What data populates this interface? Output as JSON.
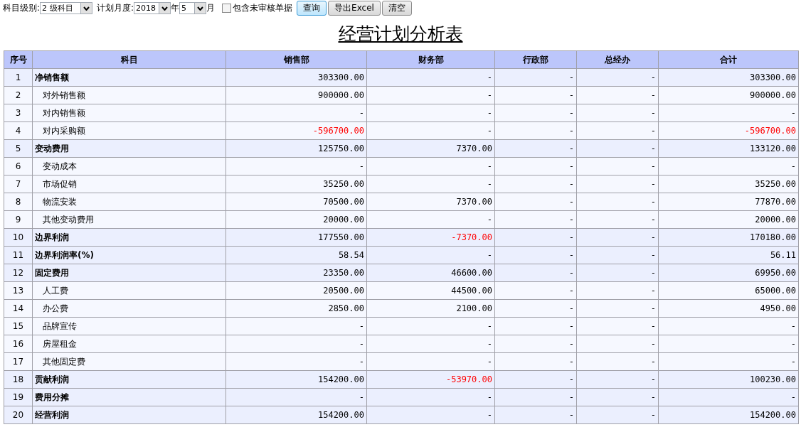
{
  "toolbar": {
    "level_label": "科目级别:",
    "level_value": "2 级科目",
    "month_label": "计划月度:",
    "year_value": "2018",
    "year_unit": "年",
    "month_value": "5",
    "month_unit": "月",
    "include_unaudited": {
      "label": "包含未审核单据",
      "checked": false
    },
    "buttons": [
      {
        "label": "查询",
        "selected": true
      },
      {
        "label": "导出Excel",
        "selected": false
      },
      {
        "label": "清空",
        "selected": false
      }
    ]
  },
  "title": "经营计划分析表",
  "table": {
    "columns": [
      "序号",
      "科目",
      "销售部",
      "财务部",
      "行政部",
      "总经办",
      "合计"
    ],
    "rows": [
      {
        "kind": "group",
        "cells": [
          {
            "text": "1",
            "negative": false
          },
          {
            "text": "净销售额",
            "negative": false
          },
          {
            "text": "303300.00",
            "negative": false
          },
          {
            "text": "-",
            "negative": false
          },
          {
            "text": "-",
            "negative": false
          },
          {
            "text": "-",
            "negative": false
          },
          {
            "text": "303300.00",
            "negative": false
          }
        ]
      },
      {
        "kind": "item",
        "cells": [
          {
            "text": "2",
            "negative": false
          },
          {
            "text": "对外销售额",
            "negative": false
          },
          {
            "text": "900000.00",
            "negative": false
          },
          {
            "text": "-",
            "negative": false
          },
          {
            "text": "-",
            "negative": false
          },
          {
            "text": "-",
            "negative": false
          },
          {
            "text": "900000.00",
            "negative": false
          }
        ]
      },
      {
        "kind": "item",
        "cells": [
          {
            "text": "3",
            "negative": false
          },
          {
            "text": "对内销售额",
            "negative": false
          },
          {
            "text": "-",
            "negative": false
          },
          {
            "text": "-",
            "negative": false
          },
          {
            "text": "-",
            "negative": false
          },
          {
            "text": "-",
            "negative": false
          },
          {
            "text": "-",
            "negative": false
          }
        ]
      },
      {
        "kind": "item",
        "cells": [
          {
            "text": "4",
            "negative": false
          },
          {
            "text": "对内采购额",
            "negative": false
          },
          {
            "text": "-596700.00",
            "negative": true
          },
          {
            "text": "-",
            "negative": false
          },
          {
            "text": "-",
            "negative": false
          },
          {
            "text": "-",
            "negative": false
          },
          {
            "text": "-596700.00",
            "negative": true
          }
        ]
      },
      {
        "kind": "group",
        "cells": [
          {
            "text": "5",
            "negative": false
          },
          {
            "text": "变动费用",
            "negative": false
          },
          {
            "text": "125750.00",
            "negative": false
          },
          {
            "text": "7370.00",
            "negative": false
          },
          {
            "text": "-",
            "negative": false
          },
          {
            "text": "-",
            "negative": false
          },
          {
            "text": "133120.00",
            "negative": false
          }
        ]
      },
      {
        "kind": "item",
        "cells": [
          {
            "text": "6",
            "negative": false
          },
          {
            "text": "变动成本",
            "negative": false
          },
          {
            "text": "-",
            "negative": false
          },
          {
            "text": "-",
            "negative": false
          },
          {
            "text": "-",
            "negative": false
          },
          {
            "text": "-",
            "negative": false
          },
          {
            "text": "-",
            "negative": false
          }
        ]
      },
      {
        "kind": "item",
        "cells": [
          {
            "text": "7",
            "negative": false
          },
          {
            "text": "市场促销",
            "negative": false
          },
          {
            "text": "35250.00",
            "negative": false
          },
          {
            "text": "-",
            "negative": false
          },
          {
            "text": "-",
            "negative": false
          },
          {
            "text": "-",
            "negative": false
          },
          {
            "text": "35250.00",
            "negative": false
          }
        ]
      },
      {
        "kind": "item",
        "cells": [
          {
            "text": "8",
            "negative": false
          },
          {
            "text": "物流安装",
            "negative": false
          },
          {
            "text": "70500.00",
            "negative": false
          },
          {
            "text": "7370.00",
            "negative": false
          },
          {
            "text": "-",
            "negative": false
          },
          {
            "text": "-",
            "negative": false
          },
          {
            "text": "77870.00",
            "negative": false
          }
        ]
      },
      {
        "kind": "item",
        "cells": [
          {
            "text": "9",
            "negative": false
          },
          {
            "text": "其他变动费用",
            "negative": false
          },
          {
            "text": "20000.00",
            "negative": false
          },
          {
            "text": "-",
            "negative": false
          },
          {
            "text": "-",
            "negative": false
          },
          {
            "text": "-",
            "negative": false
          },
          {
            "text": "20000.00",
            "negative": false
          }
        ]
      },
      {
        "kind": "group",
        "cells": [
          {
            "text": "10",
            "negative": false
          },
          {
            "text": "边界利润",
            "negative": false
          },
          {
            "text": "177550.00",
            "negative": false
          },
          {
            "text": "-7370.00",
            "negative": true
          },
          {
            "text": "-",
            "negative": false
          },
          {
            "text": "-",
            "negative": false
          },
          {
            "text": "170180.00",
            "negative": false
          }
        ]
      },
      {
        "kind": "group",
        "cells": [
          {
            "text": "11",
            "negative": false
          },
          {
            "text": "边界利润率(%)",
            "negative": false
          },
          {
            "text": "58.54",
            "negative": false
          },
          {
            "text": "-",
            "negative": false
          },
          {
            "text": "-",
            "negative": false
          },
          {
            "text": "-",
            "negative": false
          },
          {
            "text": "56.11",
            "negative": false
          }
        ]
      },
      {
        "kind": "group",
        "cells": [
          {
            "text": "12",
            "negative": false
          },
          {
            "text": "固定费用",
            "negative": false
          },
          {
            "text": "23350.00",
            "negative": false
          },
          {
            "text": "46600.00",
            "negative": false
          },
          {
            "text": "-",
            "negative": false
          },
          {
            "text": "-",
            "negative": false
          },
          {
            "text": "69950.00",
            "negative": false
          }
        ]
      },
      {
        "kind": "item",
        "cells": [
          {
            "text": "13",
            "negative": false
          },
          {
            "text": "人工费",
            "negative": false
          },
          {
            "text": "20500.00",
            "negative": false
          },
          {
            "text": "44500.00",
            "negative": false
          },
          {
            "text": "-",
            "negative": false
          },
          {
            "text": "-",
            "negative": false
          },
          {
            "text": "65000.00",
            "negative": false
          }
        ]
      },
      {
        "kind": "item",
        "cells": [
          {
            "text": "14",
            "negative": false
          },
          {
            "text": "办公费",
            "negative": false
          },
          {
            "text": "2850.00",
            "negative": false
          },
          {
            "text": "2100.00",
            "negative": false
          },
          {
            "text": "-",
            "negative": false
          },
          {
            "text": "-",
            "negative": false
          },
          {
            "text": "4950.00",
            "negative": false
          }
        ]
      },
      {
        "kind": "item",
        "cells": [
          {
            "text": "15",
            "negative": false
          },
          {
            "text": "品牌宣传",
            "negative": false
          },
          {
            "text": "-",
            "negative": false
          },
          {
            "text": "-",
            "negative": false
          },
          {
            "text": "-",
            "negative": false
          },
          {
            "text": "-",
            "negative": false
          },
          {
            "text": "-",
            "negative": false
          }
        ]
      },
      {
        "kind": "item",
        "cells": [
          {
            "text": "16",
            "negative": false
          },
          {
            "text": "房屋租金",
            "negative": false
          },
          {
            "text": "-",
            "negative": false
          },
          {
            "text": "-",
            "negative": false
          },
          {
            "text": "-",
            "negative": false
          },
          {
            "text": "-",
            "negative": false
          },
          {
            "text": "-",
            "negative": false
          }
        ]
      },
      {
        "kind": "item",
        "cells": [
          {
            "text": "17",
            "negative": false
          },
          {
            "text": "其他固定费",
            "negative": false
          },
          {
            "text": "-",
            "negative": false
          },
          {
            "text": "-",
            "negative": false
          },
          {
            "text": "-",
            "negative": false
          },
          {
            "text": "-",
            "negative": false
          },
          {
            "text": "-",
            "negative": false
          }
        ]
      },
      {
        "kind": "group",
        "cells": [
          {
            "text": "18",
            "negative": false
          },
          {
            "text": "贡献利润",
            "negative": false
          },
          {
            "text": "154200.00",
            "negative": false
          },
          {
            "text": "-53970.00",
            "negative": true
          },
          {
            "text": "-",
            "negative": false
          },
          {
            "text": "-",
            "negative": false
          },
          {
            "text": "100230.00",
            "negative": false
          }
        ]
      },
      {
        "kind": "group",
        "cells": [
          {
            "text": "19",
            "negative": false
          },
          {
            "text": "费用分摊",
            "negative": false
          },
          {
            "text": "-",
            "negative": false
          },
          {
            "text": "-",
            "negative": false
          },
          {
            "text": "-",
            "negative": false
          },
          {
            "text": "-",
            "negative": false
          },
          {
            "text": "-",
            "negative": false
          }
        ]
      },
      {
        "kind": "group",
        "cells": [
          {
            "text": "20",
            "negative": false
          },
          {
            "text": "经营利润",
            "negative": false
          },
          {
            "text": "154200.00",
            "negative": false
          },
          {
            "text": "-",
            "negative": false
          },
          {
            "text": "-",
            "negative": false
          },
          {
            "text": "-",
            "negative": false
          },
          {
            "text": "154200.00",
            "negative": false
          }
        ]
      }
    ]
  }
}
